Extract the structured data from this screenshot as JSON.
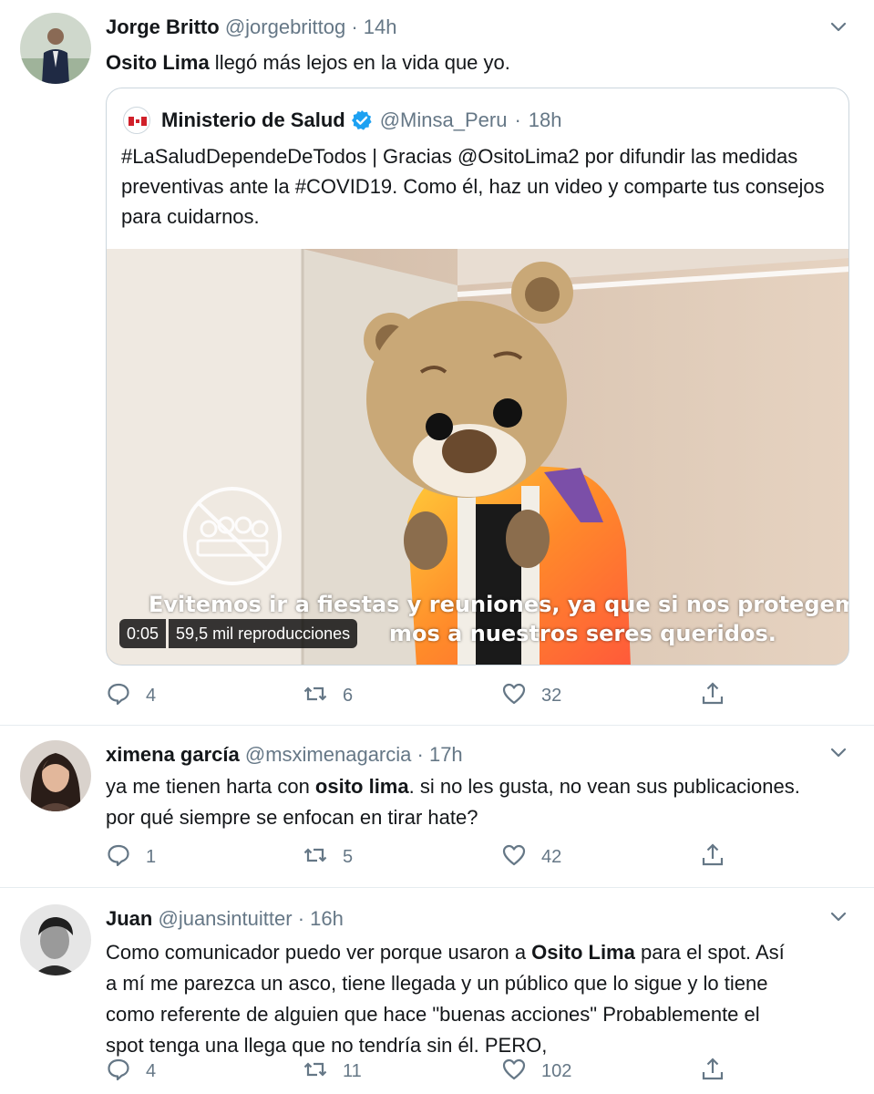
{
  "tweets": [
    {
      "name": "Jorge Britto",
      "handle": "@jorgebrittog",
      "dot": "·",
      "time": "14h",
      "text_bold": "Osito Lima",
      "text_rest": " llegó más lejos en la vida que yo.",
      "quote": {
        "name": "Ministerio de Salud",
        "handle": "@Minsa_Peru",
        "dot": "·",
        "time": "18h",
        "text": "#LaSaludDependeDeTodos | Gracias @OsitoLima2 por difundir las medidas preventivas ante la #COVID19. Como él, haz un video y comparte tus consejos para cuidarnos.",
        "video": {
          "subtitle_line1": "Evitemos ir a fiestas y reuniones, ya que si nos protegemos",
          "subtitle_line2": "mos a nuestros seres queridos.",
          "duration": "0:05",
          "views": "59,5 mil reproducciones"
        }
      },
      "replies": "4",
      "retweets": "6",
      "likes": "32"
    },
    {
      "name": "ximena garcía",
      "handle": "@msximenagarcia",
      "dot": "·",
      "time": "17h",
      "line1_pre": "ya me tienen harta con ",
      "line1_bold": "osito lima",
      "line1_post": ". si no les gusta, no vean sus publicaciones.",
      "line2": "por qué siempre se enfocan en tirar hate?",
      "replies": "1",
      "retweets": "5",
      "likes": "42"
    },
    {
      "name": "Juan",
      "handle": "@juansintuitter",
      "dot": "·",
      "time": "16h",
      "line1_pre": "Como comunicador puedo ver porque usaron a ",
      "line1_bold": "Osito Lima",
      "line1_post": " para el spot. Así",
      "line2": "a mí me parezca un asco, tiene llegada y un público que lo sigue y lo tiene",
      "line3": "como referente de alguien que hace \"buenas acciones\" Probablemente el",
      "line4": "spot tenga una llega que no tendría sin él. PERO,",
      "replies": "4",
      "retweets": "11",
      "likes": "102"
    }
  ],
  "icons": {
    "reply": "reply-icon",
    "retweet": "retweet-icon",
    "like": "heart-icon",
    "share": "share-icon",
    "caret": "chevron-down-icon",
    "verified": "verified-badge-icon"
  },
  "colors": {
    "text": "#14171a",
    "muted": "#657786",
    "border": "#e6ecf0",
    "verified": "#1da1f2"
  }
}
